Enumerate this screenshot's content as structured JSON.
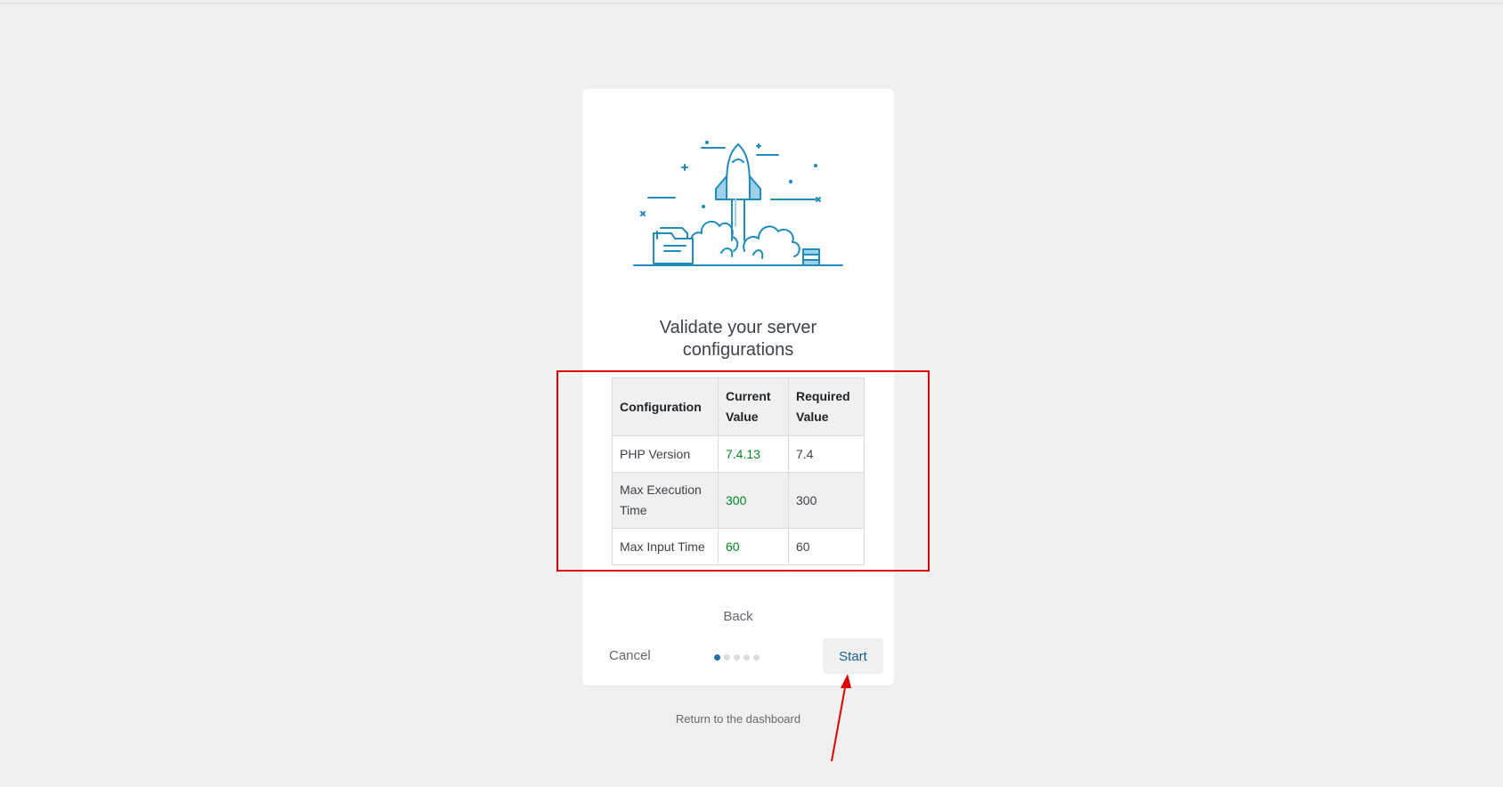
{
  "wizard": {
    "title_line1": "Validate your server",
    "title_line2": "configurations",
    "table": {
      "headers": {
        "configuration": "Configuration",
        "current_line1": "Current",
        "current_line2": "Value",
        "required_line1": "Required",
        "required_line2": "Value"
      },
      "rows": [
        {
          "name": "PHP Version",
          "current": "7.4.13",
          "required": "7.4"
        },
        {
          "name_line1": "Max Execution",
          "name_line2": "Time",
          "current": "300",
          "required": "300"
        },
        {
          "name": "Max Input Time",
          "current": "60",
          "required": "60"
        }
      ]
    },
    "back_label": "Back",
    "cancel_label": "Cancel",
    "start_label": "Start",
    "steps": {
      "total": 5,
      "current": 1
    }
  },
  "footer": {
    "return_label": "Return to the dashboard"
  },
  "colors": {
    "ok_value": "#008a20",
    "accent": "#2271b1",
    "annotation": "#e00000"
  }
}
